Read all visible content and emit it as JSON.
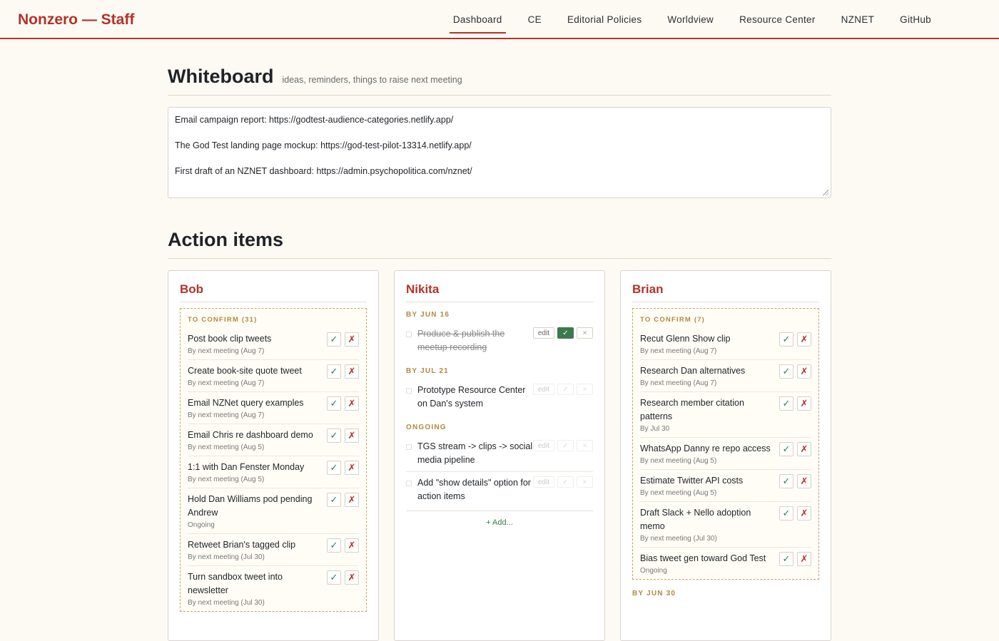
{
  "brand": "Nonzero — Staff",
  "nav": [
    "Dashboard",
    "CE",
    "Editorial Policies",
    "Worldview",
    "Resource Center",
    "NZNET",
    "GitHub"
  ],
  "whiteboard": {
    "title": "Whiteboard",
    "subtitle": "ideas, reminders, things to raise next meeting",
    "lines": [
      "Email campaign report: https://godtest-audience-categories.netlify.app/",
      "The God Test landing page mockup: https://god-test-pilot-13314.netlify.app/",
      "First draft of an NZNET dashboard: https://admin.psychopolitica.com/nznet/"
    ]
  },
  "action_items": {
    "title": "Action items",
    "bob": {
      "name": "Bob",
      "confirm_label": "TO CONFIRM (31)",
      "items": [
        {
          "title": "Post book clip tweets",
          "meta": "By next meeting (Aug 7)"
        },
        {
          "title": "Create book-site quote tweet",
          "meta": "By next meeting (Aug 7)"
        },
        {
          "title": "Email NZNet query examples",
          "meta": "By next meeting (Aug 7)"
        },
        {
          "title": "Email Chris re dashboard demo",
          "meta": "By next meeting (Aug 5)"
        },
        {
          "title": "1:1 with Dan Fenster Monday",
          "meta": "By next meeting (Aug 5)"
        },
        {
          "title": "Hold Dan Williams pod pending Andrew",
          "meta": "Ongoing"
        },
        {
          "title": "Retweet Brian's tagged clip",
          "meta": "By next meeting (Jul 30)"
        },
        {
          "title": "Turn sandbox tweet into newsletter",
          "meta": "By next meeting (Jul 30)"
        }
      ]
    },
    "nikita": {
      "name": "Nikita",
      "groups": [
        {
          "label": "BY JUN 16",
          "items": [
            {
              "title": "Produce & publish the meetup recording",
              "done": true
            }
          ]
        },
        {
          "label": "BY JUL 21",
          "items": [
            {
              "title": "Prototype Resource Center on Dan's system",
              "done": false
            }
          ]
        },
        {
          "label": "ONGOING",
          "items": [
            {
              "title": "TGS stream -> clips -> social media pipeline",
              "done": false
            },
            {
              "title": "Add \"show details\" option for action items",
              "done": false
            }
          ]
        }
      ],
      "edit_label": "edit",
      "add_label": "+ Add..."
    },
    "brian": {
      "name": "Brian",
      "confirm_label": "TO CONFIRM (7)",
      "items": [
        {
          "title": "Recut Glenn Show clip",
          "meta": "By next meeting (Aug 7)"
        },
        {
          "title": "Research Dan alternatives",
          "meta": "By next meeting (Aug 7)"
        },
        {
          "title": "Research member citation patterns",
          "meta": "By Jul 30"
        },
        {
          "title": "WhatsApp Danny re repo access",
          "meta": "By next meeting (Aug 5)"
        },
        {
          "title": "Estimate Twitter API costs",
          "meta": "By next meeting (Aug 5)"
        },
        {
          "title": "Draft Slack + Nello adoption memo",
          "meta": "By next meeting (Jul 30)"
        },
        {
          "title": "Bias tweet gen toward God Test",
          "meta": "Ongoing"
        }
      ],
      "next_group_label": "BY JUN 30"
    }
  },
  "icons": {
    "confirm": "✓",
    "reject": "✗",
    "done": "✓",
    "remove": "×"
  },
  "colors": {
    "accent": "#b3322a",
    "confirm_green": "#2e7d4f",
    "section_gold": "#b4883f"
  }
}
